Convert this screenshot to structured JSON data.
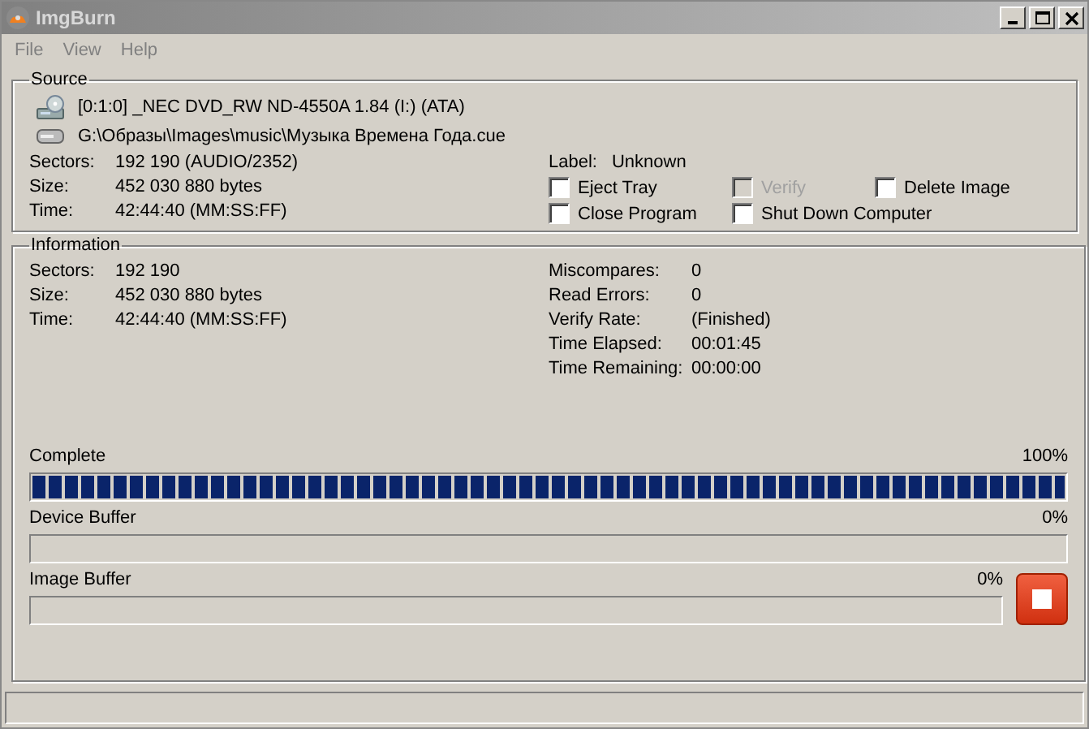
{
  "window": {
    "title": "ImgBurn"
  },
  "menu": [
    {
      "label": "File",
      "disabled": true
    },
    {
      "label": "View",
      "disabled": true
    },
    {
      "label": "Help",
      "disabled": true
    }
  ],
  "source": {
    "title": "Source",
    "drive": "[0:1:0] _NEC DVD_RW ND-4550A 1.84 (I:) (ATA)",
    "file": "G:\\Образы\\Images\\music\\Музыка Времена Года.cue",
    "details": [
      {
        "label": "Sectors:",
        "value": "192 190 (AUDIO/2352)"
      },
      {
        "label": "Size:",
        "value": "452 030 880 bytes"
      },
      {
        "label": "Time:",
        "value": "42:44:40 (MM:SS:FF)"
      }
    ],
    "disc_label": {
      "label": "Label:",
      "value": "Unknown"
    },
    "options": [
      {
        "label": "Eject Tray",
        "checked": false,
        "disabled": false
      },
      {
        "label": "Verify",
        "checked": false,
        "disabled": true
      },
      {
        "label": "Delete Image",
        "checked": false,
        "disabled": false
      },
      {
        "label": "Close Program",
        "checked": false,
        "disabled": false
      },
      {
        "label": "Shut Down Computer",
        "checked": false,
        "disabled": false
      }
    ]
  },
  "information": {
    "title": "Information",
    "left": [
      {
        "label": "Sectors:",
        "value": "192 190"
      },
      {
        "label": "Size:",
        "value": "452 030 880 bytes"
      },
      {
        "label": "Time:",
        "value": "42:44:40 (MM:SS:FF)"
      }
    ],
    "right": [
      {
        "label": "Miscompares:",
        "value": "0"
      },
      {
        "label": "Read Errors:",
        "value": "0"
      },
      {
        "label": "Verify Rate:",
        "value": "(Finished)"
      },
      {
        "label": "Time Elapsed:",
        "value": "00:01:45"
      },
      {
        "label": "Time Remaining:",
        "value": "00:00:00"
      }
    ],
    "progress": [
      {
        "label": "Complete",
        "reading": "100%",
        "level": 1
      },
      {
        "label": "Device Buffer",
        "reading": "0%",
        "level": 0
      },
      {
        "label": "Image Buffer",
        "reading": "0%",
        "level": 0
      }
    ]
  }
}
